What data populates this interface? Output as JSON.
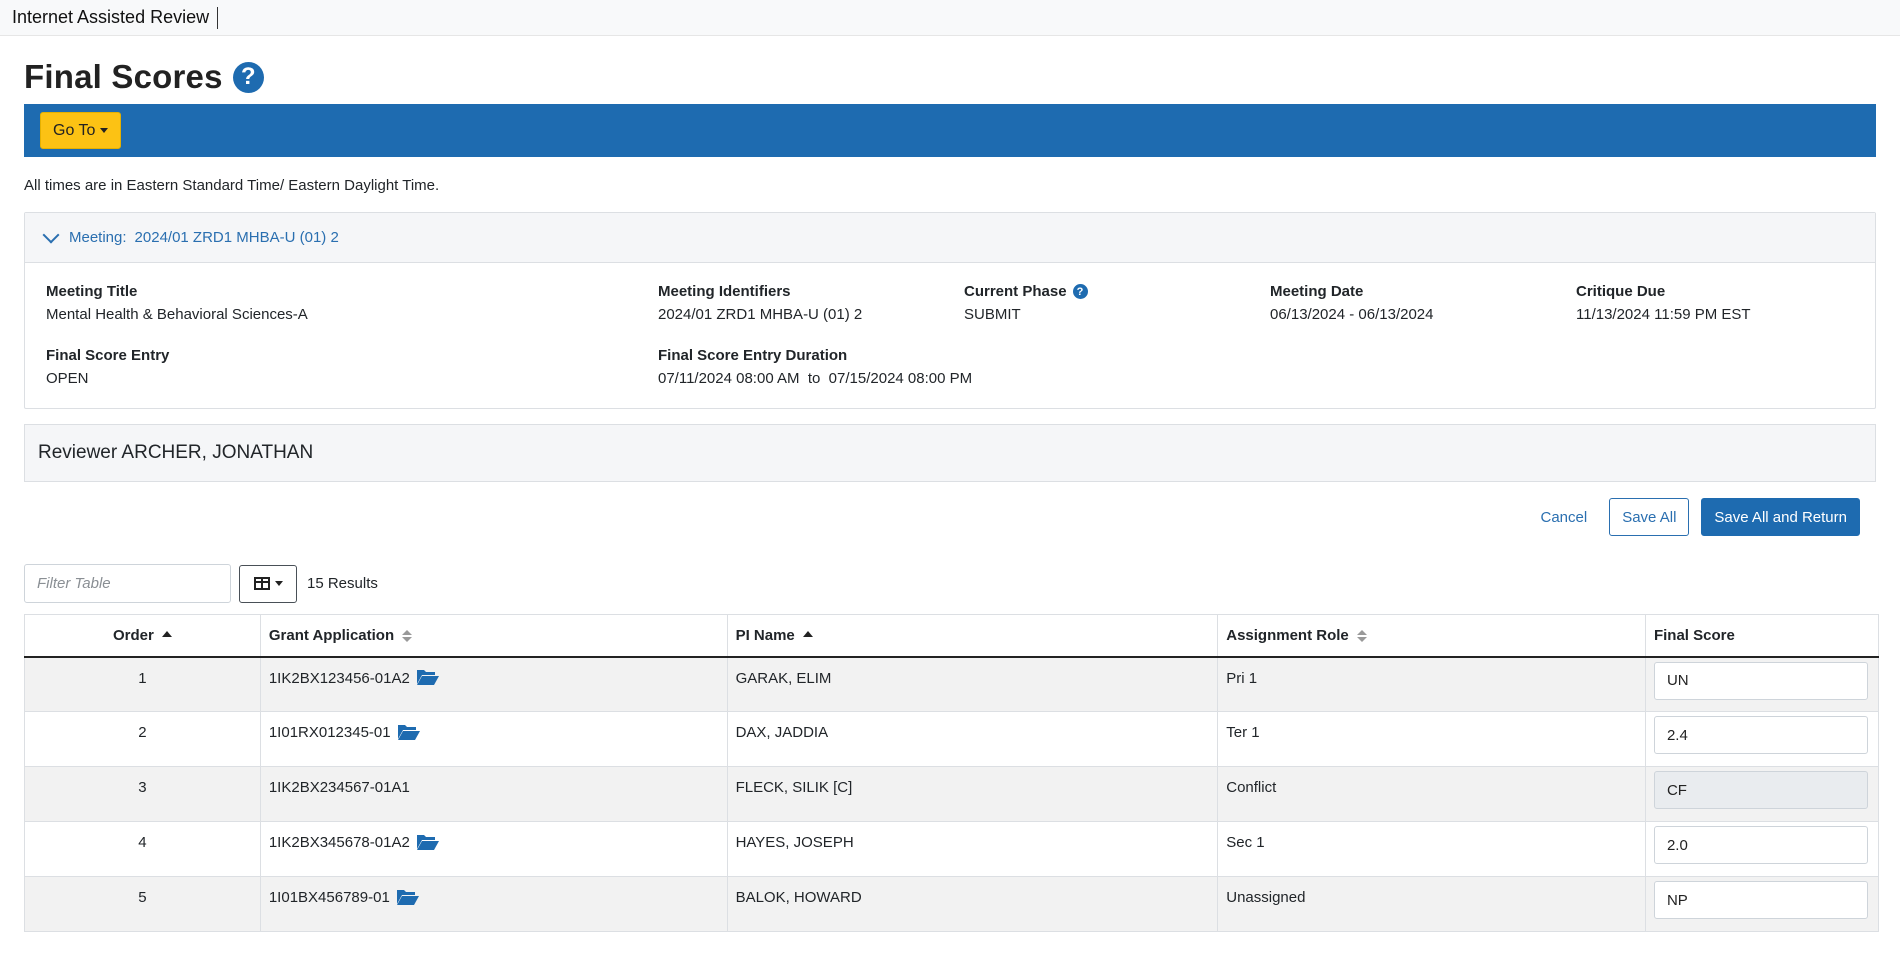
{
  "app": {
    "title": "Internet Assisted Review"
  },
  "page": {
    "title": "Final Scores",
    "help_glyph": "?",
    "goto_label": "Go To",
    "timezone_note": "All times are in Eastern Standard Time/ Eastern Daylight Time."
  },
  "meeting": {
    "header_label": "Meeting:",
    "header_value": "2024/01 ZRD1 MHBA-U (01) 2",
    "fields": {
      "title": {
        "label": "Meeting Title",
        "value": "Mental Health & Behavioral Sciences-A"
      },
      "identifiers": {
        "label": "Meeting Identifiers",
        "value": "2024/01 ZRD1 MHBA-U (01) 2"
      },
      "phase": {
        "label": "Current Phase",
        "value": "SUBMIT"
      },
      "date": {
        "label": "Meeting Date",
        "value": "06/13/2024 - 06/13/2024"
      },
      "critique": {
        "label": "Critique Due",
        "value": "11/13/2024 11:59 PM EST"
      },
      "entry": {
        "label": "Final Score Entry",
        "value": "OPEN"
      },
      "duration": {
        "label": "Final Score Entry Duration",
        "value": "07/11/2024 08:00 AM  to  07/15/2024 08:00 PM"
      }
    }
  },
  "reviewer": {
    "label": "Reviewer ARCHER, JONATHAN"
  },
  "actions": {
    "cancel": "Cancel",
    "save_all": "Save All",
    "save_return": "Save All and Return"
  },
  "table": {
    "filter_placeholder": "Filter Table",
    "results": "15 Results",
    "columns": {
      "order": "Order",
      "grant": "Grant Application",
      "pi": "PI Name",
      "role": "Assignment Role",
      "score": "Final Score"
    },
    "rows": [
      {
        "order": "1",
        "grant": "1IK2BX123456-01A2",
        "pi": "GARAK, ELIM",
        "role": "Pri 1",
        "score": "UN"
      },
      {
        "order": "2",
        "grant": "1I01RX012345-01",
        "pi": "DAX, JADDIA",
        "role": "Ter 1",
        "score": "2.4"
      },
      {
        "order": "3",
        "grant": "1IK2BX234567-01A1",
        "pi": "FLECK, SILIK [C]",
        "role": "Conflict",
        "score": "CF"
      },
      {
        "order": "4",
        "grant": "1IK2BX345678-01A2",
        "pi": "HAYES, JOSEPH",
        "role": "Sec 1",
        "score": "2.0"
      },
      {
        "order": "5",
        "grant": "1I01BX456789-01",
        "pi": "BALOK, HOWARD",
        "role": "Unassigned",
        "score": "NP"
      }
    ]
  },
  "colors": {
    "brand_blue": "#1e6bb0",
    "goto_yellow": "#fcc214",
    "folder_blue": "#1e6bb0"
  }
}
